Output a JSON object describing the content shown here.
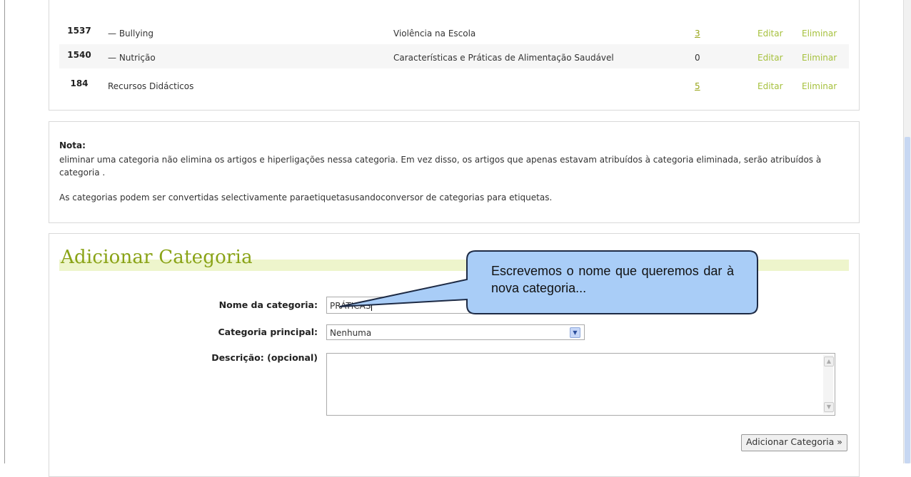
{
  "table": {
    "rows": [
      {
        "id": "1537",
        "name": "— Bullying",
        "description": "Violência na Escola",
        "count": "3",
        "count_is_link": true,
        "edit": "Editar",
        "delete": "Eliminar"
      },
      {
        "id": "1540",
        "name": "— Nutrição",
        "description": "Características e Práticas de Alimentação Saudável",
        "count": "0",
        "count_is_link": false,
        "edit": "Editar",
        "delete": "Eliminar"
      },
      {
        "id": "184",
        "name": "Recursos Didácticos",
        "description": "",
        "count": "5",
        "count_is_link": true,
        "edit": "Editar",
        "delete": "Eliminar"
      }
    ]
  },
  "note": {
    "title": "Nota:",
    "text1": "eliminar uma categoria não elimina os artigos e hiperligações nessa categoria. Em vez disso, os artigos que apenas estavam atribuídos à categoria eliminada, serão atribuídos à categoria .",
    "text2": "As categorias podem ser convertidas selectivamente paraetiquetasusandoconversor de categorias para etiquetas."
  },
  "form": {
    "title": "Adicionar Categoria",
    "name_label": "Nome da categoria:",
    "name_value": "PRÁTICAS",
    "parent_label": "Categoria principal:",
    "parent_value": "Nenhuma",
    "description_label": "Descrição: (opcional)",
    "description_value": "",
    "submit_label": "Adicionar Categoria »"
  },
  "callout": {
    "text": "Escrevemos o nome que queremos dar à nova categoria..."
  },
  "colors": {
    "accent_green": "#8aa317",
    "link_green": "#a6c13d",
    "callout_fill": "#a9cdf7"
  }
}
